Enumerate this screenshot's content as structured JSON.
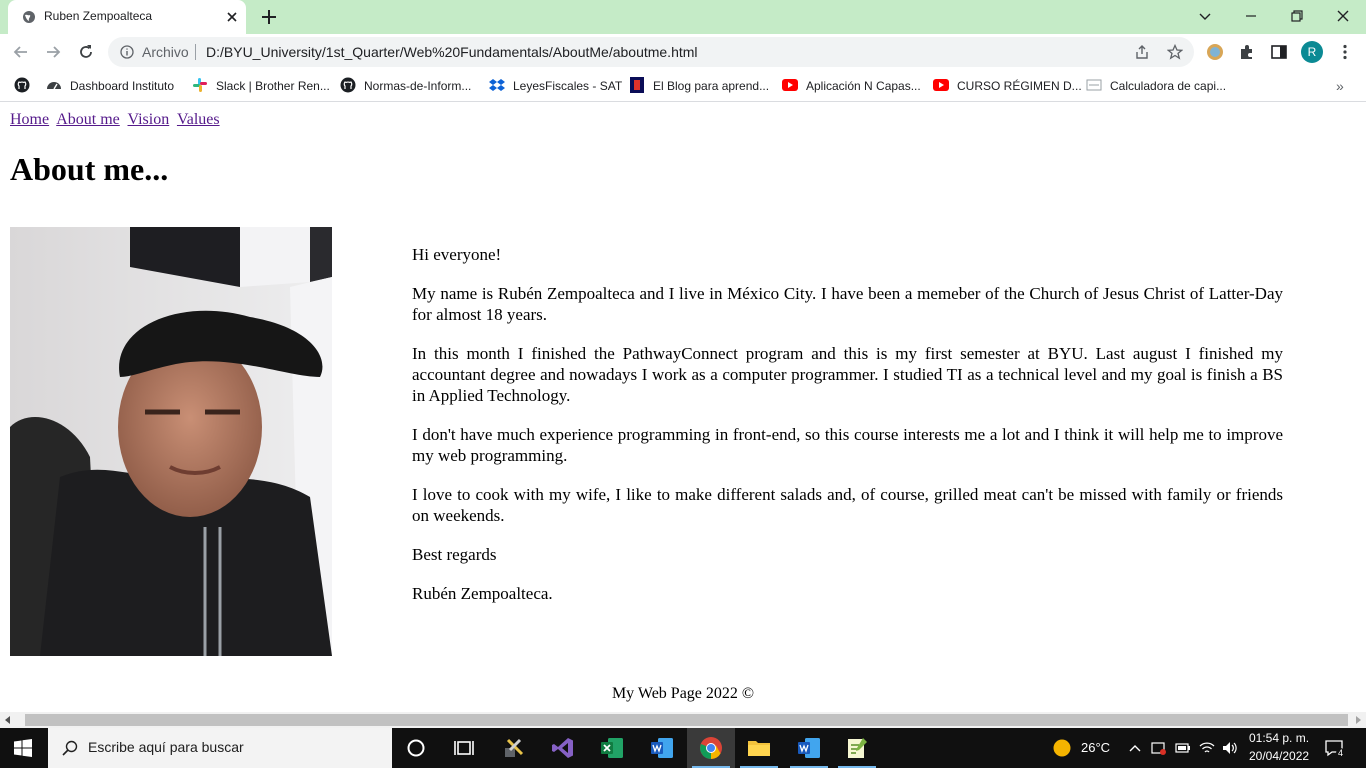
{
  "browser": {
    "tab_title": "Ruben Zempoalteca",
    "omnibox": {
      "scheme_label": "Archivo",
      "url": "D:/BYU_University/1st_Quarter/Web%20Fundamentals/AboutMe/aboutme.html"
    },
    "profile_initial": "R",
    "bookmarks": [
      {
        "label": "",
        "icon": "github-icon"
      },
      {
        "label": "Dashboard Instituto",
        "icon": "dashboard-icon"
      },
      {
        "label": "Slack | Brother Ren...",
        "icon": "slack-icon"
      },
      {
        "label": "Normas-de-Inform...",
        "icon": "github-icon"
      },
      {
        "label": "LeyesFiscales - SAT",
        "icon": "dropbox-icon"
      },
      {
        "label": "El Blog para aprend...",
        "icon": "blog-icon"
      },
      {
        "label": "Aplicación N Capas...",
        "icon": "youtube-icon"
      },
      {
        "label": "CURSO RÉGIMEN D...",
        "icon": "youtube-icon"
      },
      {
        "label": "Calculadora de capi...",
        "icon": "calculator-icon"
      }
    ]
  },
  "page": {
    "nav": [
      "Home",
      "About me",
      "Vision",
      "Values"
    ],
    "title": "About me...",
    "paragraphs": [
      "Hi everyone!",
      "My name is Rubén Zempoalteca and I live in México City. I have been a memeber of the Church of Jesus Christ of Latter-Day for almost 18 years.",
      "In this month I finished the PathwayConnect program and this is my first semester at BYU. Last august I finished my accountant degree and nowadays I work as a computer programmer. I studied TI as a technical level and my goal is finish a BS in Applied Technology.",
      "I don't have much experience programming in front-end, so this course interests me a lot and I think it will help me to improve my web programming.",
      "I love to cook with my wife, I like to make different salads and, of course, grilled meat can't be missed with family or friends on weekends.",
      "Best regards",
      "Rubén Zempoalteca."
    ],
    "footer": "My Web Page 2022 ©"
  },
  "taskbar": {
    "search_placeholder": "Escribe aquí para buscar",
    "weather": "26°C",
    "time": "01:54 p. m.",
    "date": "20/04/2022",
    "notifications": "4"
  }
}
